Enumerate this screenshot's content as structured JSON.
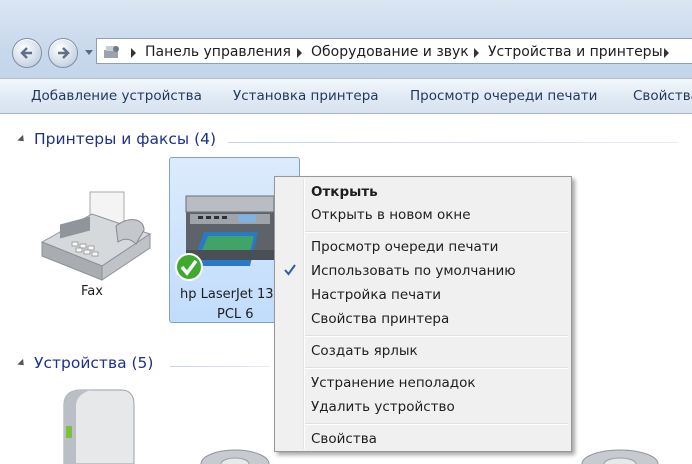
{
  "address": {
    "crumbs": [
      "Панель управления",
      "Оборудование и звук",
      "Устройства и принтеры"
    ]
  },
  "toolbar": {
    "add_device": "Добавление устройства",
    "install_printer": "Установка принтера",
    "view_queue": "Просмотр очереди печати",
    "properties": "Свойства"
  },
  "groups": {
    "printers": "Принтеры и факсы (4)",
    "devices": "Устройства (5)"
  },
  "printers": [
    {
      "label": "Fax",
      "icon": "fax-icon"
    },
    {
      "label_line1": "hp LaserJet 13",
      "label_line2": "PCL 6",
      "icon": "printer-icon",
      "default": true
    }
  ],
  "context_menu": {
    "items": [
      {
        "label": "Открыть",
        "bold": true
      },
      {
        "label": "Открыть в новом окне"
      },
      {
        "label": "Просмотр очереди печати"
      },
      {
        "label": "Использовать по умолчанию",
        "checked": true
      },
      {
        "label": "Настройка печати"
      },
      {
        "label": "Свойства принтера"
      },
      {
        "label": "Создать ярлык"
      },
      {
        "label": "Устранение неполадок"
      },
      {
        "label": "Удалить устройство"
      },
      {
        "label": "Свойства"
      }
    ]
  },
  "colors": {
    "group_header": "#1e3287",
    "toolbar_text": "#1e395b",
    "selection": "#c1dcfc",
    "check": "#2a5db0"
  }
}
